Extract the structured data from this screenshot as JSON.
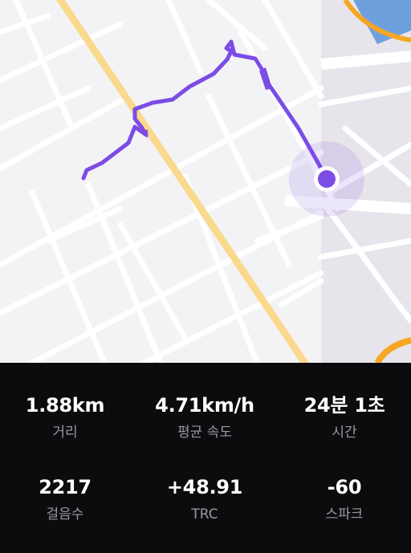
{
  "map": {
    "route_color": "#7b4ce6",
    "main_road_color": "#fbd98c",
    "highway_color": "#f5a623",
    "water_color": "#4a90d9",
    "location_icon": "current-location-icon"
  },
  "stats": [
    {
      "value": "1.88km",
      "label": "거리"
    },
    {
      "value": "4.71km/h",
      "label": "평균 속도"
    },
    {
      "value": "24분 1초",
      "label": "시간"
    },
    {
      "value": "2217",
      "label": "걸음수"
    },
    {
      "value": "+48.91",
      "label": "TRC"
    },
    {
      "value": "-60",
      "label": "스파크"
    }
  ]
}
